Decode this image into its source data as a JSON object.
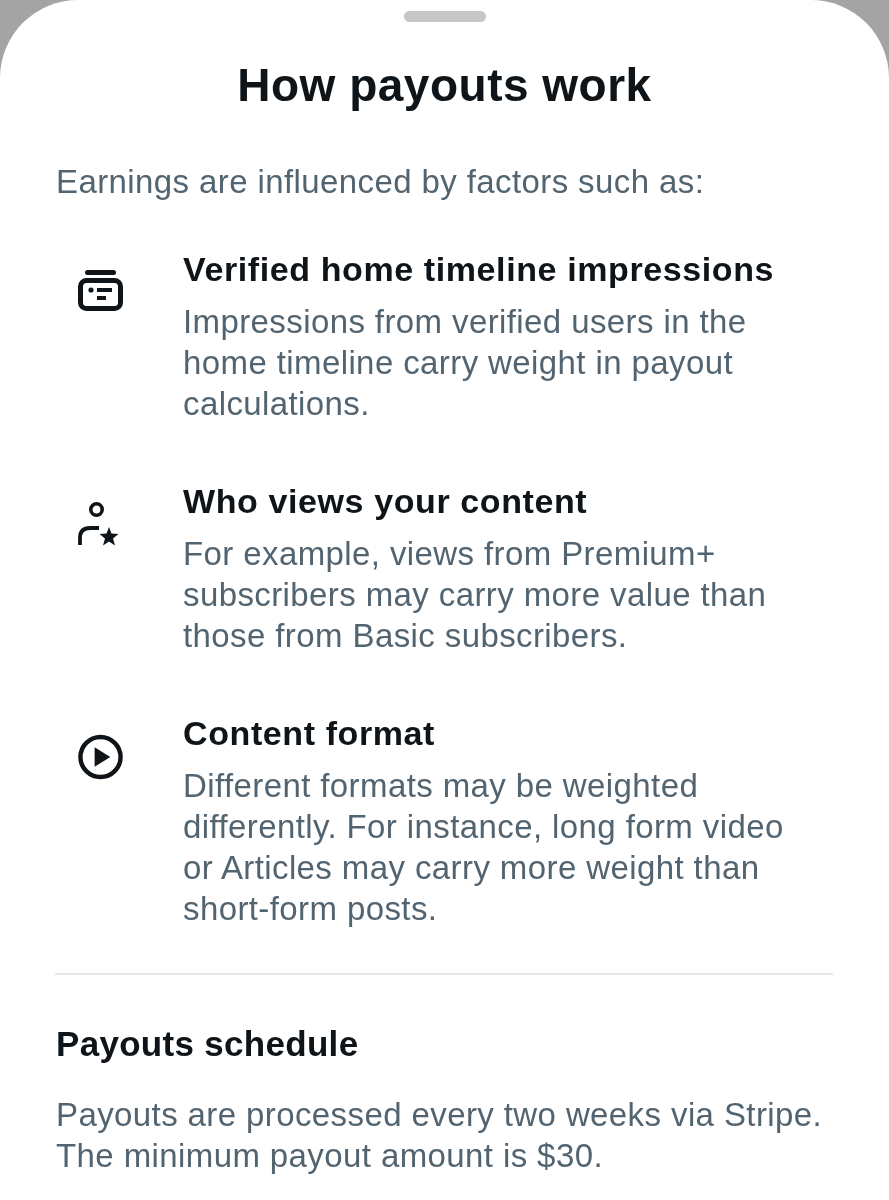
{
  "sheet": {
    "title": "How payouts work",
    "intro": "Earnings are influenced by factors such as:"
  },
  "factors": [
    {
      "kind": "timeline",
      "heading": "Verified home timeline impressions",
      "description": "Impressions from verified users in the home timeline carry weight in payout calculations."
    },
    {
      "kind": "audience",
      "heading": "Who views your content",
      "description": "For example, views from Premium+ subscribers may carry more value than those from Basic subscribers."
    },
    {
      "kind": "format",
      "heading": "Content format",
      "description": "Different formats may be weighted differently. For instance, long form video or Articles may carry more weight than short-form posts."
    }
  ],
  "schedule": {
    "heading": "Payouts schedule",
    "description": "Payouts are processed every two weeks via Stripe. The minimum payout amount is $30."
  }
}
